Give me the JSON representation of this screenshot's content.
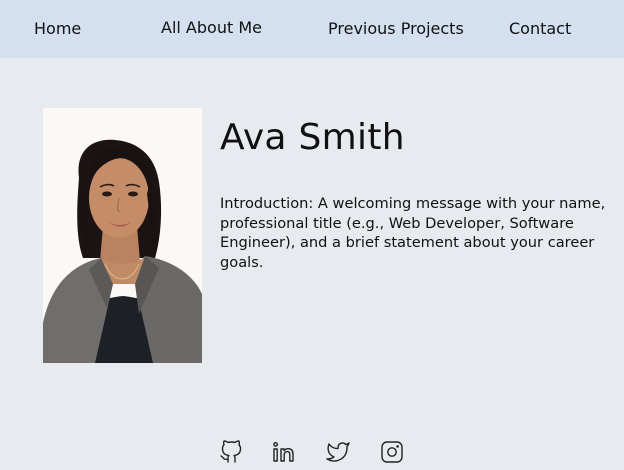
{
  "nav": {
    "home": "Home",
    "about": "All About Me",
    "projects": "Previous Projects",
    "contact": "Contact"
  },
  "profile": {
    "name": "Ava Smith",
    "intro": "Introduction: A welcoming message with your name, professional title (e.g., Web Developer, Software Engineer), and a brief statement about your career goals."
  },
  "social": [
    {
      "icon": "github-icon"
    },
    {
      "icon": "linkedin-icon"
    },
    {
      "icon": "twitter-icon"
    },
    {
      "icon": "instagram-icon"
    }
  ],
  "colors": {
    "nav_background": "#d4e0f0",
    "page_background": "#e7eaee",
    "text": "#111111"
  }
}
